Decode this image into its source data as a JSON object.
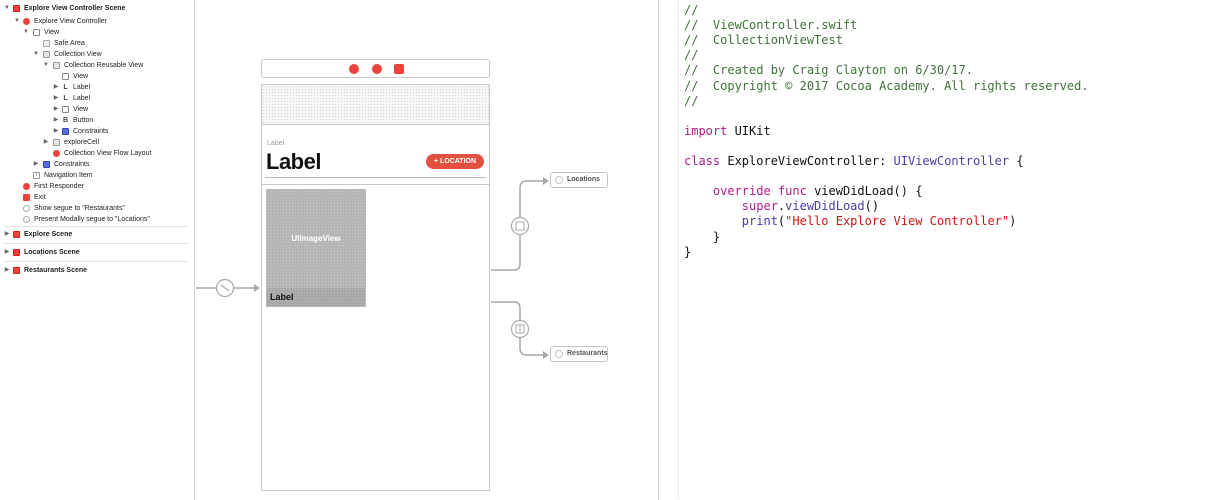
{
  "outline": {
    "rows": [
      {
        "label": "Explore View Controller Scene",
        "icon": "scene-icon",
        "bold": true
      },
      {
        "label": "Explore View Controller",
        "icon": "view-controller-icon"
      },
      {
        "label": "View",
        "icon": "view-icon"
      },
      {
        "label": "Safe Area",
        "icon": "safe-area-icon"
      },
      {
        "label": "Collection View",
        "icon": "collection-view-icon"
      },
      {
        "label": "Collection Reusable View",
        "icon": "reusable-view-icon"
      },
      {
        "label": "View",
        "icon": "view-icon"
      },
      {
        "label": "Label",
        "icon": "label-icon"
      },
      {
        "label": "Label",
        "icon": "label-icon"
      },
      {
        "label": "View",
        "icon": "view-icon"
      },
      {
        "label": "Button",
        "icon": "button-icon"
      },
      {
        "label": "Constraints",
        "icon": "constraints-icon"
      },
      {
        "label": "exploreCell",
        "icon": "cell-icon"
      },
      {
        "label": "Collection View Flow Layout",
        "icon": "flow-layout-icon"
      },
      {
        "label": "Constraints",
        "icon": "constraints-icon"
      },
      {
        "label": "Navigation Item",
        "icon": "navigation-item-icon"
      },
      {
        "label": "First Responder",
        "icon": "first-responder-icon"
      },
      {
        "label": "Exit",
        "icon": "exit-icon"
      },
      {
        "label": "Show segue to \"Restaurants\"",
        "icon": "segue-icon"
      },
      {
        "label": "Present Modally segue to \"Locations\"",
        "icon": "segue-icon"
      },
      {
        "label": "Explore Scene",
        "icon": "scene-icon",
        "bold": true
      },
      {
        "label": "Locations Scene",
        "icon": "scene-icon",
        "bold": true
      },
      {
        "label": "Restaurants Scene",
        "icon": "scene-icon",
        "bold": true
      }
    ]
  },
  "canvas": {
    "header_small_label": "Label",
    "header_big_label": "Label",
    "location_button": "+ LOCATION",
    "image_view_label": "UIImageView",
    "cell_label": "Label",
    "dest_locations": "Locations",
    "dest_restaurants": "Restaurants"
  },
  "editor": {
    "lines": [
      [
        {
          "t": "//",
          "c": "cmt"
        }
      ],
      [
        {
          "t": "//  ViewController.swift",
          "c": "cmt"
        }
      ],
      [
        {
          "t": "//  CollectionViewTest",
          "c": "cmt"
        }
      ],
      [
        {
          "t": "//",
          "c": "cmt"
        }
      ],
      [
        {
          "t": "//  Created by Craig Clayton on 6/30/17.",
          "c": "cmt"
        }
      ],
      [
        {
          "t": "//  Copyright © 2017 Cocoa Academy. All rights reserved.",
          "c": "cmt"
        }
      ],
      [
        {
          "t": "//",
          "c": "cmt"
        }
      ],
      [],
      [
        {
          "t": "import",
          "c": "kw"
        },
        {
          "t": " UIKit",
          "c": "pl"
        }
      ],
      [],
      [
        {
          "t": "class",
          "c": "kw"
        },
        {
          "t": " ExploreViewController: ",
          "c": "pl"
        },
        {
          "t": "UIViewController",
          "c": "ty"
        },
        {
          "t": " {",
          "c": "pl"
        }
      ],
      [],
      [
        {
          "t": "    ",
          "c": "pl"
        },
        {
          "t": "override",
          "c": "kw"
        },
        {
          "t": " ",
          "c": "pl"
        },
        {
          "t": "func",
          "c": "kw"
        },
        {
          "t": " viewDidLoad() {",
          "c": "pl"
        }
      ],
      [
        {
          "t": "        ",
          "c": "pl"
        },
        {
          "t": "super",
          "c": "kw"
        },
        {
          "t": ".",
          "c": "pl"
        },
        {
          "t": "viewDidLoad",
          "c": "fn"
        },
        {
          "t": "()",
          "c": "pl"
        }
      ],
      [
        {
          "t": "        ",
          "c": "pl"
        },
        {
          "t": "print",
          "c": "fn"
        },
        {
          "t": "(",
          "c": "pl"
        },
        {
          "t": "\"Hello Explore View Controller\"",
          "c": "str"
        },
        {
          "t": ")",
          "c": "pl"
        }
      ],
      [
        {
          "t": "    }",
          "c": "pl"
        }
      ],
      [
        {
          "t": "}",
          "c": "pl"
        }
      ]
    ]
  }
}
